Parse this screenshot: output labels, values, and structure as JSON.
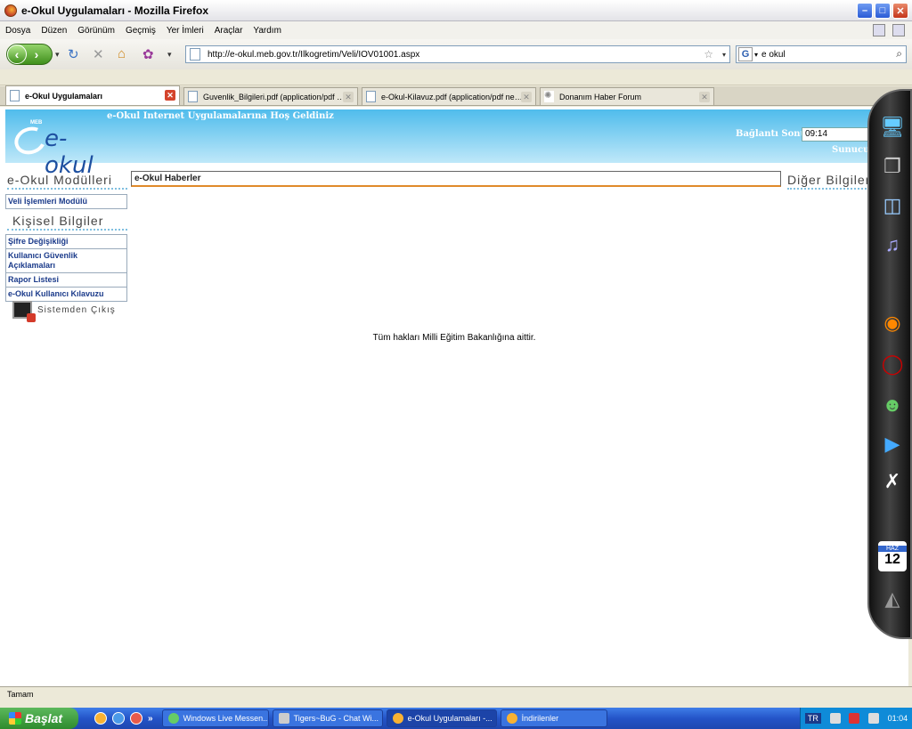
{
  "window": {
    "title": "e-Okul Uygulamaları - Mozilla Firefox"
  },
  "menu": [
    "Dosya",
    "Düzen",
    "Görünüm",
    "Geçmiş",
    "Yer İmleri",
    "Araçlar",
    "Yardım"
  ],
  "address": {
    "url": "http://e-okul.meb.gov.tr/Ilkogretim/Veli/IOV01001.aspx"
  },
  "search": {
    "value": "e okul",
    "engine": "G"
  },
  "tabs": [
    {
      "label": "e-Okul Uygulamaları"
    },
    {
      "label": "Guvenlik_Bilgileri.pdf (application/pdf n..."
    },
    {
      "label": "e-Okul-Kilavuz.pdf (application/pdf nes..."
    },
    {
      "label": "Donanım Haber Forum"
    }
  ],
  "banner": {
    "welcome": "e-Okul Internet Uygulamalarına Hoş Geldiniz",
    "logo_small": "MEB",
    "logo_text": "e-okul",
    "connection_label": "Bağlantı Sonu:",
    "connection_value": "09:14",
    "server_label": "Sunucu:"
  },
  "modules": {
    "title": "e-Okul Modülleri",
    "items": [
      "Veli İşlemleri Modülü"
    ]
  },
  "personal": {
    "title": "Kişisel Bilgiler",
    "items": [
      "Şifre Değişikliği",
      "Kullanıcı Güvenlik Açıklamaları",
      "Rapor Listesi",
      "e-Okul Kullanıcı Kılavuzu"
    ]
  },
  "exit_label": "Sistemden Çıkış",
  "news_title": "e-Okul Haberler",
  "other_title": "Diğer Bilgiler",
  "footer": "Tüm hakları Milli Eğitim Bakanlığına aittir.",
  "status": "Tamam",
  "dock": {
    "calendar_month": "HAZ",
    "calendar_day": "12"
  },
  "taskbar": {
    "start": "Başlat",
    "more": "»",
    "tasks": [
      "Windows Live Messen...",
      "Tigers~BuG - Chat Wi...",
      "e-Okul Uygulamaları -...",
      "İndirilenler"
    ],
    "lang": "TR",
    "clock": "01:04"
  }
}
